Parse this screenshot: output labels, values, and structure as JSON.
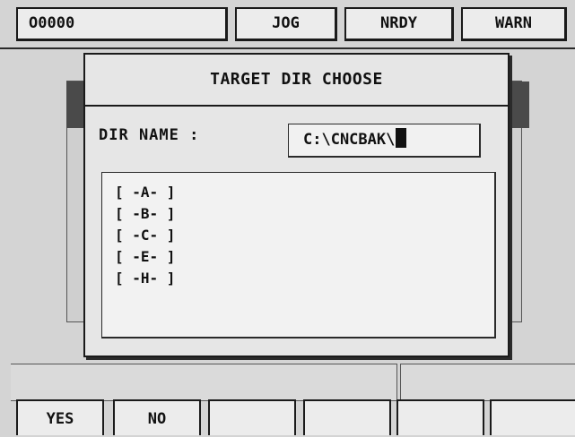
{
  "status_bar": {
    "program_number": "O0000",
    "mode": "JOG",
    "ready_state": "NRDY",
    "alarm_state": "WARN"
  },
  "dialog": {
    "title": "TARGET DIR CHOOSE",
    "dir_name_label": "DIR NAME :",
    "dir_name_value": "C:\\CNCBAK\\",
    "directories": [
      "[ -A- ]",
      "[ -B- ]",
      "[ -C- ]",
      "[ -E- ]",
      "[ -H- ]"
    ]
  },
  "softkeys": {
    "yes_label": "YES",
    "no_label": "NO"
  }
}
